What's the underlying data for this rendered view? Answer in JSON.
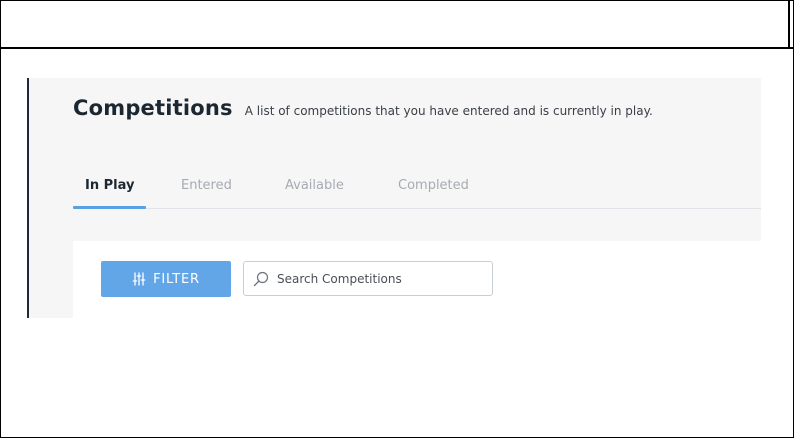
{
  "page": {
    "title": "Competitions",
    "subtitle": "A list of competitions that you have entered and is currently in play."
  },
  "tabs": [
    {
      "label": "In Play",
      "active": true
    },
    {
      "label": "Entered",
      "active": false
    },
    {
      "label": "Available",
      "active": false
    },
    {
      "label": "Completed",
      "active": false
    }
  ],
  "toolbar": {
    "filter_label": "FILTER",
    "filter_icon": "sliders-icon",
    "search_placeholder": "Search Competitions",
    "search_value": "",
    "search_icon": "search-icon"
  },
  "colors": {
    "accent": "#5aa0e3",
    "button": "#63a6e8",
    "title": "#1c2731",
    "tab_inactive": "#a6abb2",
    "panel_bg": "#f6f6f7"
  }
}
